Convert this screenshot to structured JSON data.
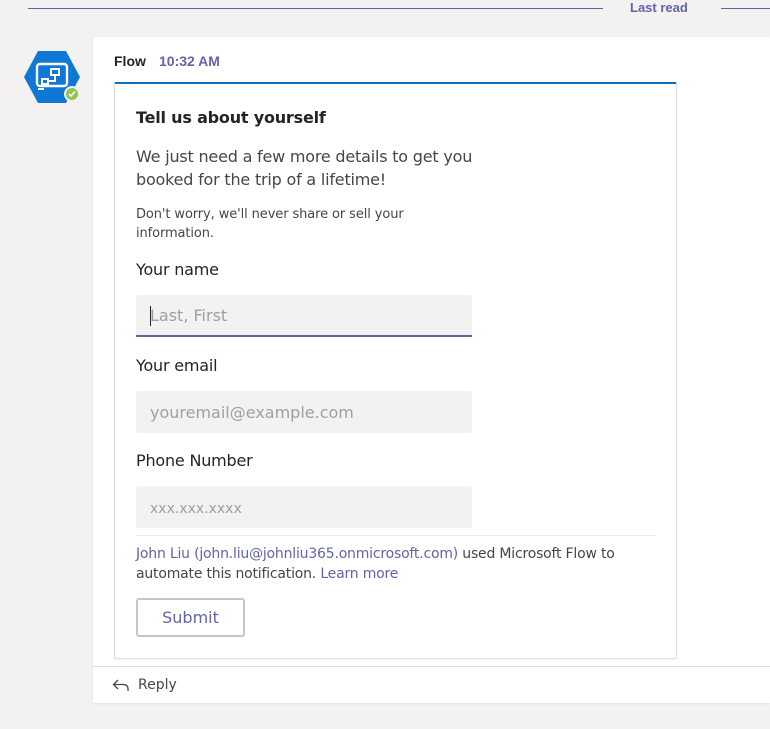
{
  "divider": {
    "label": "Last read"
  },
  "message": {
    "sender": "Flow",
    "timestamp": "10:32 AM"
  },
  "card": {
    "title": "Tell us about yourself",
    "subtitle": "We just need a few more details to get you booked for the trip of a lifetime!",
    "note": "Don't worry, we'll never share or sell your information.",
    "fields": [
      {
        "label": "Your name",
        "placeholder": "Last, First",
        "value": ""
      },
      {
        "label": "Your email",
        "placeholder": "youremail@example.com",
        "value": ""
      },
      {
        "label": "Phone Number",
        "placeholder": "xxx.xxx.xxxx",
        "value": ""
      }
    ],
    "attribution": {
      "user_link": "John Liu (john.liu@johnliu365.onmicrosoft.com)",
      "middle_text": " used Microsoft Flow to automate this notification. ",
      "learn_more": "Learn more"
    },
    "submit_label": "Submit"
  },
  "reply": {
    "label": "Reply"
  },
  "colors": {
    "accent": "#6264a7",
    "card_top_border": "#0f6cbd",
    "avatar": "#0f78d4",
    "status_available": "#92c353"
  },
  "icons": {
    "avatar": "flow-app-icon",
    "status": "available-check-icon",
    "reply": "reply-arrow-icon"
  }
}
